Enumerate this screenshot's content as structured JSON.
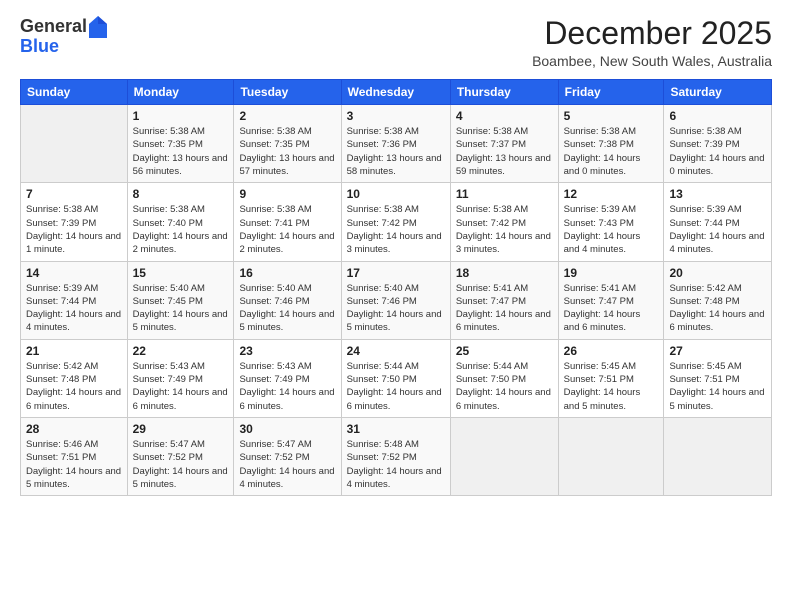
{
  "logo": {
    "general": "General",
    "blue": "Blue"
  },
  "header": {
    "month": "December 2025",
    "location": "Boambee, New South Wales, Australia"
  },
  "days_of_week": [
    "Sunday",
    "Monday",
    "Tuesday",
    "Wednesday",
    "Thursday",
    "Friday",
    "Saturday"
  ],
  "weeks": [
    [
      null,
      {
        "day": "1",
        "sunrise": "5:38 AM",
        "sunset": "7:35 PM",
        "daylight": "13 hours and 56 minutes."
      },
      {
        "day": "2",
        "sunrise": "5:38 AM",
        "sunset": "7:35 PM",
        "daylight": "13 hours and 57 minutes."
      },
      {
        "day": "3",
        "sunrise": "5:38 AM",
        "sunset": "7:36 PM",
        "daylight": "13 hours and 58 minutes."
      },
      {
        "day": "4",
        "sunrise": "5:38 AM",
        "sunset": "7:37 PM",
        "daylight": "13 hours and 59 minutes."
      },
      {
        "day": "5",
        "sunrise": "5:38 AM",
        "sunset": "7:38 PM",
        "daylight": "14 hours and 0 minutes."
      },
      {
        "day": "6",
        "sunrise": "5:38 AM",
        "sunset": "7:39 PM",
        "daylight": "14 hours and 0 minutes."
      }
    ],
    [
      {
        "day": "7",
        "sunrise": "5:38 AM",
        "sunset": "7:39 PM",
        "daylight": "14 hours and 1 minute."
      },
      {
        "day": "8",
        "sunrise": "5:38 AM",
        "sunset": "7:40 PM",
        "daylight": "14 hours and 2 minutes."
      },
      {
        "day": "9",
        "sunrise": "5:38 AM",
        "sunset": "7:41 PM",
        "daylight": "14 hours and 2 minutes."
      },
      {
        "day": "10",
        "sunrise": "5:38 AM",
        "sunset": "7:42 PM",
        "daylight": "14 hours and 3 minutes."
      },
      {
        "day": "11",
        "sunrise": "5:38 AM",
        "sunset": "7:42 PM",
        "daylight": "14 hours and 3 minutes."
      },
      {
        "day": "12",
        "sunrise": "5:39 AM",
        "sunset": "7:43 PM",
        "daylight": "14 hours and 4 minutes."
      },
      {
        "day": "13",
        "sunrise": "5:39 AM",
        "sunset": "7:44 PM",
        "daylight": "14 hours and 4 minutes."
      }
    ],
    [
      {
        "day": "14",
        "sunrise": "5:39 AM",
        "sunset": "7:44 PM",
        "daylight": "14 hours and 4 minutes."
      },
      {
        "day": "15",
        "sunrise": "5:40 AM",
        "sunset": "7:45 PM",
        "daylight": "14 hours and 5 minutes."
      },
      {
        "day": "16",
        "sunrise": "5:40 AM",
        "sunset": "7:46 PM",
        "daylight": "14 hours and 5 minutes."
      },
      {
        "day": "17",
        "sunrise": "5:40 AM",
        "sunset": "7:46 PM",
        "daylight": "14 hours and 5 minutes."
      },
      {
        "day": "18",
        "sunrise": "5:41 AM",
        "sunset": "7:47 PM",
        "daylight": "14 hours and 6 minutes."
      },
      {
        "day": "19",
        "sunrise": "5:41 AM",
        "sunset": "7:47 PM",
        "daylight": "14 hours and 6 minutes."
      },
      {
        "day": "20",
        "sunrise": "5:42 AM",
        "sunset": "7:48 PM",
        "daylight": "14 hours and 6 minutes."
      }
    ],
    [
      {
        "day": "21",
        "sunrise": "5:42 AM",
        "sunset": "7:48 PM",
        "daylight": "14 hours and 6 minutes."
      },
      {
        "day": "22",
        "sunrise": "5:43 AM",
        "sunset": "7:49 PM",
        "daylight": "14 hours and 6 minutes."
      },
      {
        "day": "23",
        "sunrise": "5:43 AM",
        "sunset": "7:49 PM",
        "daylight": "14 hours and 6 minutes."
      },
      {
        "day": "24",
        "sunrise": "5:44 AM",
        "sunset": "7:50 PM",
        "daylight": "14 hours and 6 minutes."
      },
      {
        "day": "25",
        "sunrise": "5:44 AM",
        "sunset": "7:50 PM",
        "daylight": "14 hours and 6 minutes."
      },
      {
        "day": "26",
        "sunrise": "5:45 AM",
        "sunset": "7:51 PM",
        "daylight": "14 hours and 5 minutes."
      },
      {
        "day": "27",
        "sunrise": "5:45 AM",
        "sunset": "7:51 PM",
        "daylight": "14 hours and 5 minutes."
      }
    ],
    [
      {
        "day": "28",
        "sunrise": "5:46 AM",
        "sunset": "7:51 PM",
        "daylight": "14 hours and 5 minutes."
      },
      {
        "day": "29",
        "sunrise": "5:47 AM",
        "sunset": "7:52 PM",
        "daylight": "14 hours and 5 minutes."
      },
      {
        "day": "30",
        "sunrise": "5:47 AM",
        "sunset": "7:52 PM",
        "daylight": "14 hours and 4 minutes."
      },
      {
        "day": "31",
        "sunrise": "5:48 AM",
        "sunset": "7:52 PM",
        "daylight": "14 hours and 4 minutes."
      },
      null,
      null,
      null
    ]
  ]
}
